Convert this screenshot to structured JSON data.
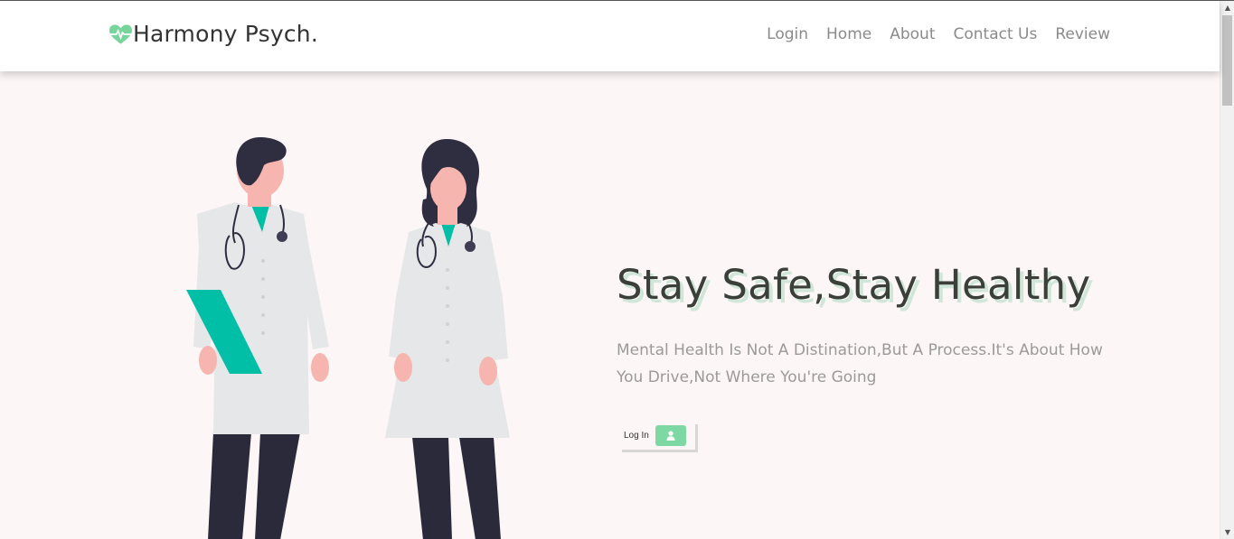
{
  "brand": {
    "name": "Harmony Psych.",
    "icon": "heart-pulse-icon",
    "icon_color": "#77d49a"
  },
  "nav": {
    "items": [
      "Login",
      "Home",
      "About",
      "Contact Us",
      "Review"
    ]
  },
  "hero": {
    "headline": "Stay Safe,Stay Healthy",
    "subtext": "Mental Health Is Not A Distination,But A Process.It's About How You Drive,Not Where You're Going",
    "login_button_label": "Log In",
    "login_button_icon": "user-icon"
  },
  "colors": {
    "accent": "#7ed8a3",
    "hero_bg": "#fdf6f6",
    "headline": "#3a3f3a",
    "headline_shadow": "#cfe6d8",
    "teal": "#00bfa6"
  }
}
